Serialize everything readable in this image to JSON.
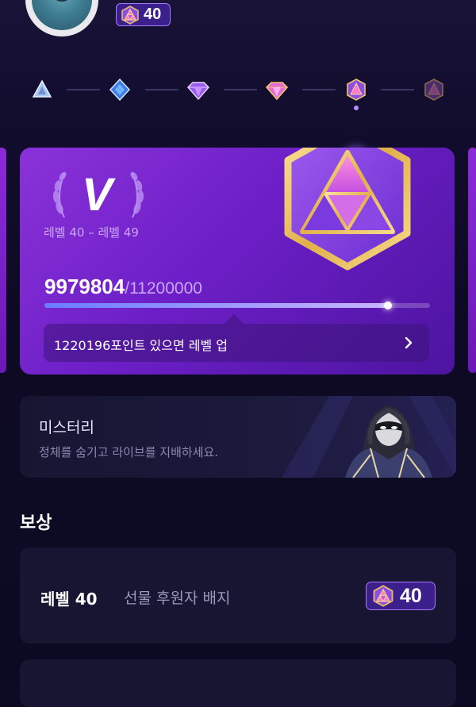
{
  "profile": {
    "avatar_icon": "avatar-icon",
    "level_chip": {
      "icon": "gem-badge-icon",
      "value": "40"
    }
  },
  "tiers": {
    "icons": [
      "tier-1-icon",
      "tier-2-icon",
      "tier-3-icon",
      "tier-4-icon",
      "tier-5-icon",
      "tier-6-icon"
    ],
    "selected_index": 4
  },
  "level_card": {
    "roman": "V",
    "range": "레벨 40 – 레벨 49",
    "current_points": "9979804",
    "total_points": "/11200000",
    "progress_fraction": 0.891,
    "hint": "1220196포인트 있으면 레벨 업",
    "badge_icon": "level-v-badge-icon"
  },
  "mystery": {
    "title": "미스터리",
    "description": "정체를 숨기고 라이브를 지배하세요.",
    "figure_icon": "masked-figure-icon"
  },
  "rewards": {
    "title": "보상",
    "items": [
      {
        "level": "레벨 40",
        "name": "선물 후원자 배지",
        "badge_value": "40"
      }
    ]
  },
  "colors": {
    "accent": "#a47bff",
    "card_purple": "#7a28cf",
    "background": "#0d0a24"
  }
}
